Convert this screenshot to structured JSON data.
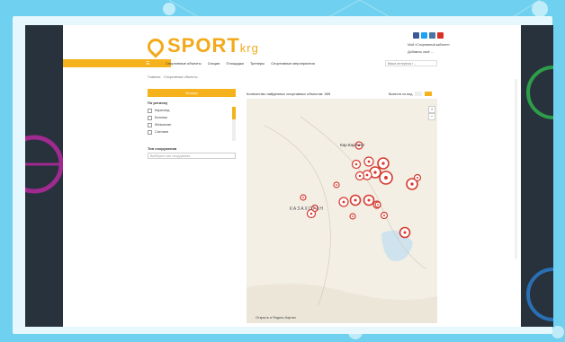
{
  "site": {
    "logo_main": "SPORT",
    "logo_suffix": "krg",
    "toplinks": [
      "Мой «Спортивный кабинет»",
      "Добавить своё ..."
    ],
    "social_colors": [
      "#3b5998",
      "#1da1f2",
      "#4c75a3",
      "#d93025"
    ]
  },
  "nav": {
    "items": [
      "Спортивные объекты",
      "Секции",
      "Площадки",
      "Тренеры",
      "Спортивные мероприятия"
    ],
    "search_placeholder": "Ваши интересы / ..."
  },
  "breadcrumb": "Главная · Спортивные объекты",
  "sidebar": {
    "filter_label": "Фильтр",
    "region_title": "По региону",
    "regions": [
      "Карагинд",
      "Балхаш",
      "Жезказган",
      "Сатпаев"
    ],
    "type_title": "Тип сооружения",
    "type_placeholder": "Выберите тип сооружения"
  },
  "map": {
    "header": "Количество найденных спортивных объектов: 365",
    "toggle_label": "Вывести на вид",
    "labels": {
      "city": "Кар.Кар.Кент",
      "country": "КАЗАХСТАН"
    },
    "footer": "Открыть в Яндекс.Картах",
    "accent": "#d63a2f"
  },
  "colors": {
    "brand": "#f3a91a",
    "frame": "#6fd0ef",
    "dark": "#27323c"
  }
}
